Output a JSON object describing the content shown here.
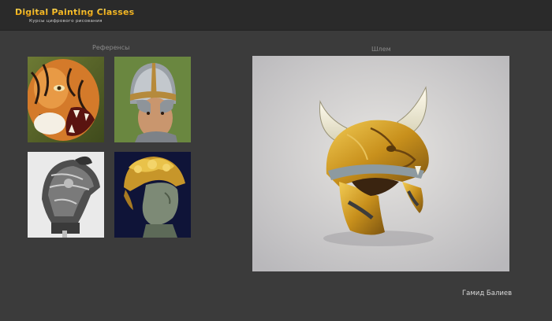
{
  "header": {
    "logo_title": "Digital Painting Classes",
    "logo_subtitle": "Курсы цифрового рисования"
  },
  "references": {
    "label": "Референсы",
    "items": [
      {
        "icon": "tiger-photo"
      },
      {
        "icon": "knight-helmet-photo"
      },
      {
        "icon": "ornate-silver-helmet-photo"
      },
      {
        "icon": "gold-helmet-statue-photo"
      }
    ]
  },
  "artwork": {
    "label": "Шлем",
    "icon": "horned-lion-helmet-painting"
  },
  "author": "Гамид Балиев",
  "colors": {
    "background": "#3b3b3b",
    "header": "#2a2a2a",
    "logo_accent": "#f2b21b"
  }
}
